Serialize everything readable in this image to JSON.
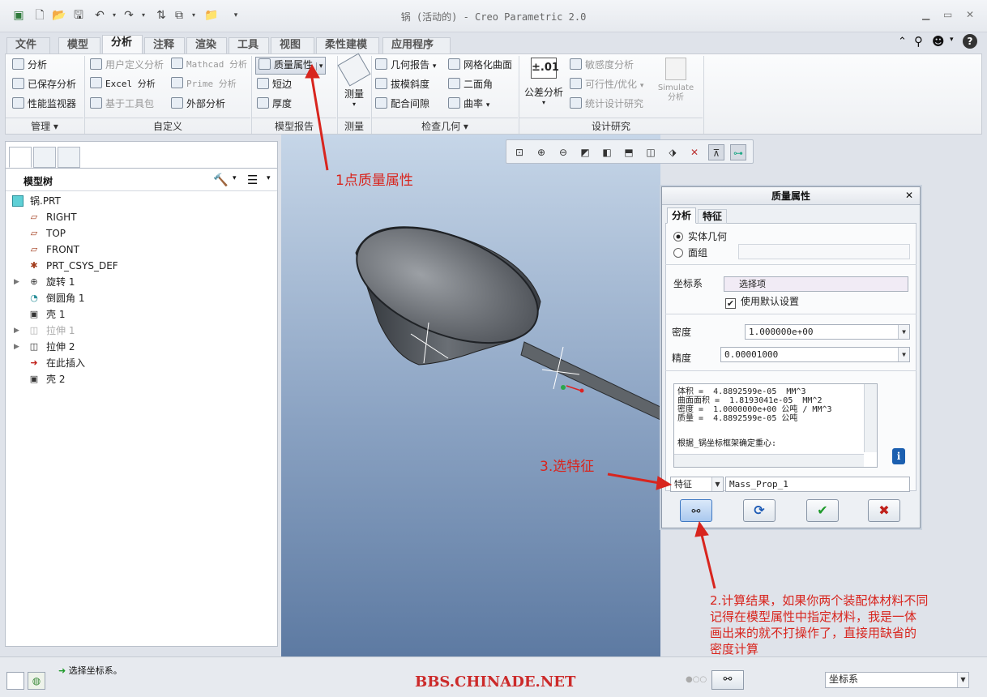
{
  "window": {
    "title": "锅 (活动的) - Creo Parametric 2.0"
  },
  "tabs": [
    {
      "label": "文件",
      "dropdown": "▾"
    },
    {
      "label": "模型"
    },
    {
      "label": "分析"
    },
    {
      "label": "注释"
    },
    {
      "label": "渲染"
    },
    {
      "label": "工具"
    },
    {
      "label": "视图"
    },
    {
      "label": "柔性建模"
    },
    {
      "label": "应用程序"
    }
  ],
  "ribbon": {
    "manage": {
      "analysis": "分析",
      "saved_analysis": "已保存分析",
      "perf_monitor": "性能监视器",
      "group": "管理"
    },
    "custom": {
      "user_defined": "用户定义分析",
      "excel": "Excel 分析",
      "toolkit": "基于工具包",
      "mathcad": "Mathcad 分析",
      "prime": "Prime 分析",
      "external": "外部分析",
      "group": "自定义"
    },
    "model_report": {
      "mass_props": "质量属性",
      "short_edge": "短边",
      "thickness": "厚度",
      "group": "模型报告"
    },
    "measure": {
      "label": "测量",
      "group": "测量"
    },
    "inspect": {
      "geom_report": "几何报告",
      "draft": "拔模斜度",
      "clearance": "配合间隙",
      "mesh_surface": "网格化曲面",
      "dihedral": "二面角",
      "curvature": "曲率",
      "group": "检查几何"
    },
    "design_study": {
      "tolerance": "公差分析",
      "tolerance_icon": "±.01",
      "sensitivity": "敏感度分析",
      "feasibility": "可行性/优化",
      "statistical": "统计设计研究",
      "simulate_top": "Simulate",
      "simulate_bottom": "分析",
      "group": "设计研究"
    }
  },
  "left_panel": {
    "header": "模型树",
    "items": [
      {
        "label": "锅.PRT",
        "icon": "part-icon"
      },
      {
        "label": "RIGHT",
        "icon": "datum-plane-icon"
      },
      {
        "label": "TOP",
        "icon": "datum-plane-icon"
      },
      {
        "label": "FRONT",
        "icon": "datum-plane-icon"
      },
      {
        "label": "PRT_CSYS_DEF",
        "icon": "csys-icon"
      },
      {
        "label": "旋转 1",
        "icon": "revolve-icon"
      },
      {
        "label": "倒圆角 1",
        "icon": "round-icon"
      },
      {
        "label": "壳 1",
        "icon": "shell-icon"
      },
      {
        "label": "拉伸 1",
        "icon": "extrude-icon"
      },
      {
        "label": "拉伸 2",
        "icon": "extrude-icon"
      },
      {
        "label": "在此插入",
        "icon": "insert-here-icon"
      },
      {
        "label": "壳 2",
        "icon": "shell-icon"
      }
    ]
  },
  "dialog": {
    "title": "质量属性",
    "tabs": [
      "分析",
      "特征"
    ],
    "radio_solid": "实体几何",
    "radio_quilt": "面组",
    "csys_label": "坐标系",
    "csys_value": "选择项",
    "use_default": "使用默认设置",
    "density_label": "密度",
    "density_value": "1.000000e+00",
    "accuracy_label": "精度",
    "accuracy_value": "0.00001000",
    "results": [
      "体积 =  4.8892599e-05  MM^3",
      "曲面面积 =  1.8193041e-05  MM^2",
      "密度 =  1.0000000e+00 公吨 / MM^3",
      "质量 =  4.8892599e-05 公吨"
    ],
    "results_note": "根据_锅坐标框架确定重心:",
    "feature_select": "特征",
    "feature_name": "Mass_Prop_1"
  },
  "annotations": {
    "step1": "1点质量属性",
    "step3": "3.选特征",
    "step2_lines": [
      "2.计算结果，如果你两个装配体材料不同",
      "记得在模型属性中指定材料，我是一体",
      "画出来的就不打操作了，直接用缺省的",
      "密度计算"
    ]
  },
  "status": {
    "message": "选择坐标系。",
    "watermark": "BBS.CHINADE.NET",
    "filter": "坐标系"
  },
  "colors": {
    "annotation": "#d8251e",
    "watermark": "#cc2a2a"
  }
}
